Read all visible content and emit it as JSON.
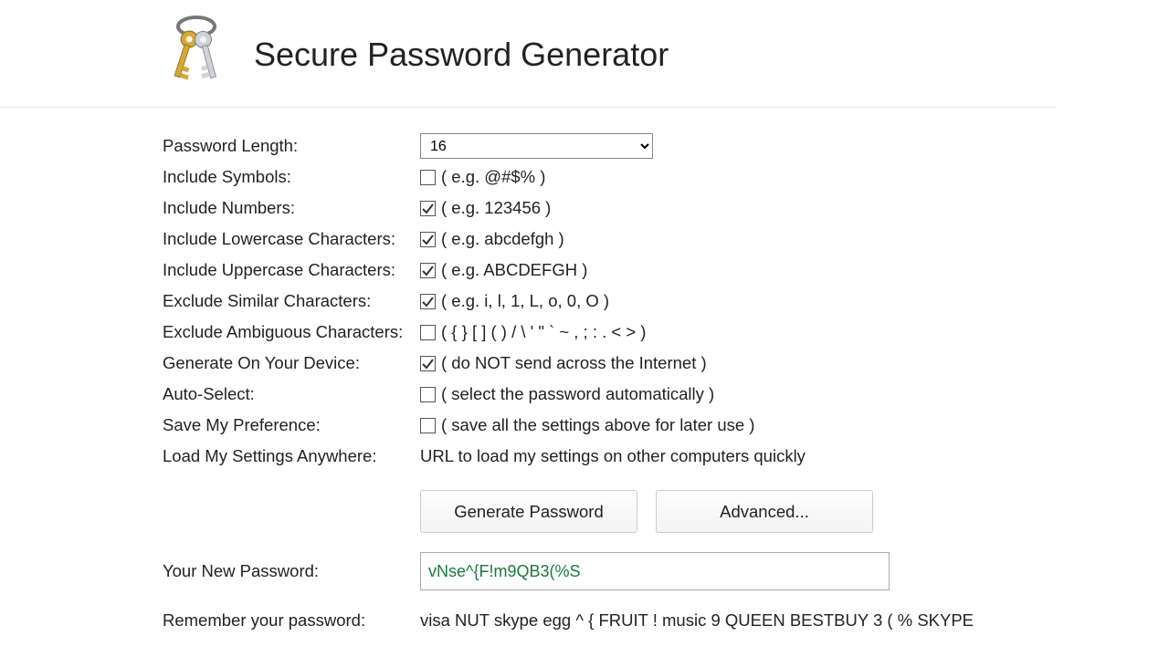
{
  "title": "Secure Password Generator",
  "options": {
    "length": {
      "label": "Password Length:",
      "value": "16"
    },
    "symbols": {
      "label": "Include Symbols:",
      "checked": false,
      "hint": "( e.g. @#$% )"
    },
    "numbers": {
      "label": "Include Numbers:",
      "checked": true,
      "hint": "( e.g. 123456 )"
    },
    "lower": {
      "label": "Include Lowercase Characters:",
      "checked": true,
      "hint": "( e.g. abcdefgh )"
    },
    "upper": {
      "label": "Include Uppercase Characters:",
      "checked": true,
      "hint": "( e.g. ABCDEFGH )"
    },
    "similar": {
      "label": "Exclude Similar Characters:",
      "checked": true,
      "hint": "( e.g. i, l, 1, L, o, 0, O )"
    },
    "ambiguous": {
      "label": "Exclude Ambiguous Characters:",
      "checked": false,
      "hint": "( { } [ ] ( ) / \\ ' \" ` ~ , ; : . < > )"
    },
    "device": {
      "label": "Generate On Your Device:",
      "checked": true,
      "hint": "( do NOT send across the Internet )"
    },
    "autosel": {
      "label": "Auto-Select:",
      "checked": false,
      "hint": "( select the password automatically )"
    },
    "savepref": {
      "label": "Save My Preference:",
      "checked": false,
      "hint": "( save all the settings above for later use )"
    },
    "loadurl": {
      "label": "Load My Settings Anywhere:",
      "text": "URL to load my settings on other computers quickly"
    }
  },
  "buttons": {
    "generate": "Generate Password",
    "advanced": "Advanced..."
  },
  "output": {
    "label": "Your New Password:",
    "value": "vNse^{F!m9QB3(%S",
    "mnemonic_label": "Remember your password:",
    "mnemonic": "visa NUT skype egg ^ { FRUIT ! music 9 QUEEN BESTBUY 3 ( % SKYPE"
  }
}
